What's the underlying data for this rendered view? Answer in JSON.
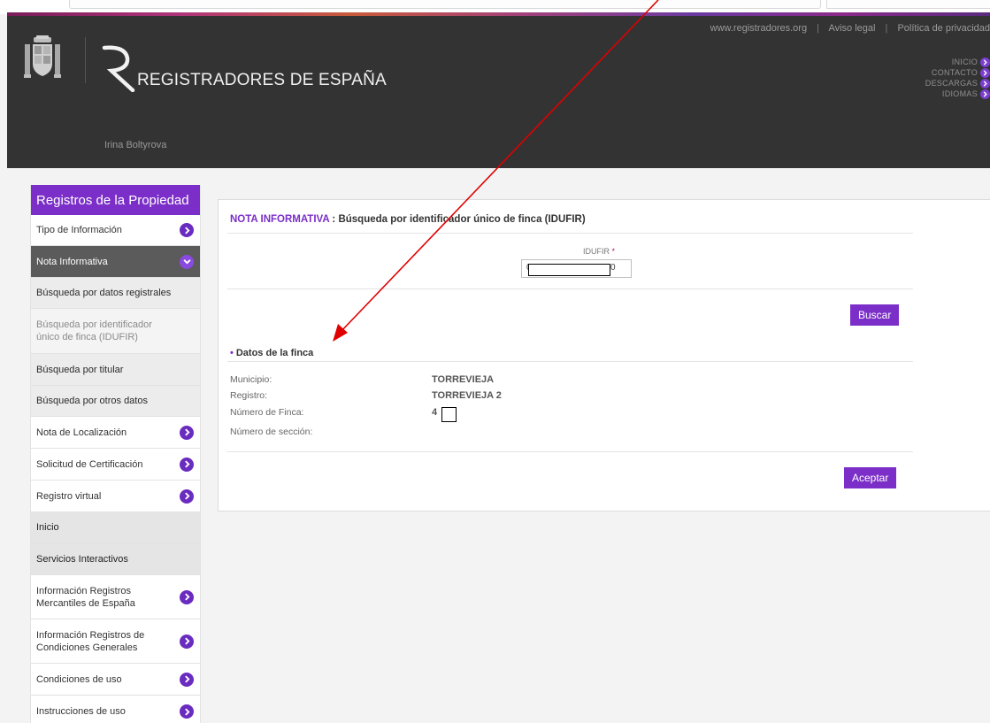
{
  "header": {
    "brand_name": "REGISTRADORES DE ESPAÑA",
    "user_name": "Irina Boltyrova",
    "top_links": {
      "site": "www.registradores.org",
      "legal": "Aviso legal",
      "privacy": "Política de privacidad"
    },
    "right_nav": [
      "INICIO",
      "CONTACTO",
      "DESCARGAS",
      "IDIOMAS"
    ]
  },
  "sidebar": {
    "title": "Registros de la Propiedad",
    "items": [
      {
        "label": "Tipo de Información"
      },
      {
        "label": "Nota Informativa"
      },
      {
        "label": "Búsqueda por datos registrales"
      },
      {
        "label": "Búsqueda por identificador único de finca (IDUFIR)"
      },
      {
        "label": "Búsqueda por titular"
      },
      {
        "label": "Búsqueda por otros datos"
      },
      {
        "label": "Nota de Localización"
      },
      {
        "label": "Solicitud de Certificación"
      },
      {
        "label": "Registro virtual"
      },
      {
        "label": "Inicio"
      },
      {
        "label": "Servicios Interactivos"
      },
      {
        "label": "Información Registros Mercantiles de España"
      },
      {
        "label": "Información Registros de Condiciones Generales"
      },
      {
        "label": "Condiciones de uso"
      },
      {
        "label": "Instrucciones de uso"
      }
    ]
  },
  "main": {
    "title_accent": "NOTA INFORMATIVA",
    "title_rest": " : Búsqueda por identificador único de finca (IDUFIR)",
    "idufir_label": "IDUFIR",
    "idufir_required": "*",
    "idufir_value_start": "0:",
    "idufir_value_end": "0",
    "search_button": "Buscar",
    "section_bullet": "•",
    "section_title": "Datos de la finca",
    "fields": [
      {
        "label": "Municipio:",
        "value": "TORREVIEJA"
      },
      {
        "label": "Registro:",
        "value": "TORREVIEJA 2"
      },
      {
        "label": "Número de Finca:",
        "value": "4"
      },
      {
        "label": "Número de sección:",
        "value": ""
      }
    ],
    "accept_button": "Aceptar"
  },
  "colors": {
    "accent": "#7b2fc8",
    "header_bg": "#333333",
    "arrow": "#e00000"
  }
}
